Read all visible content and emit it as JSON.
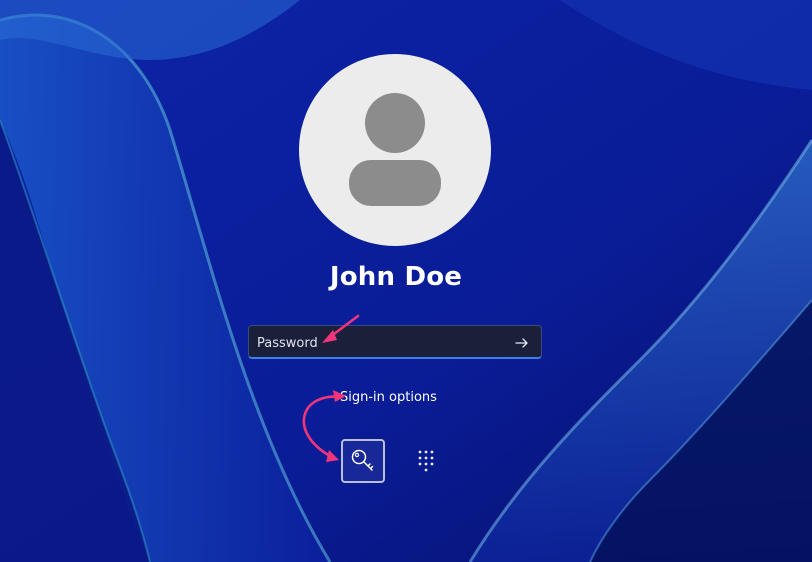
{
  "user": {
    "name": "John Doe"
  },
  "password": {
    "placeholder": "Password",
    "value": ""
  },
  "signin_options": {
    "label": "Sign-in options",
    "options": [
      {
        "icon": "key-icon",
        "selected": true
      },
      {
        "icon": "pin-keypad-icon",
        "selected": false
      }
    ]
  },
  "colors": {
    "background": "#0a1f9a",
    "accent": "#3f7fe6",
    "annotation_arrow": "#f0357a",
    "avatar_bg": "#ececec",
    "avatar_figure": "#8c8c8c"
  }
}
